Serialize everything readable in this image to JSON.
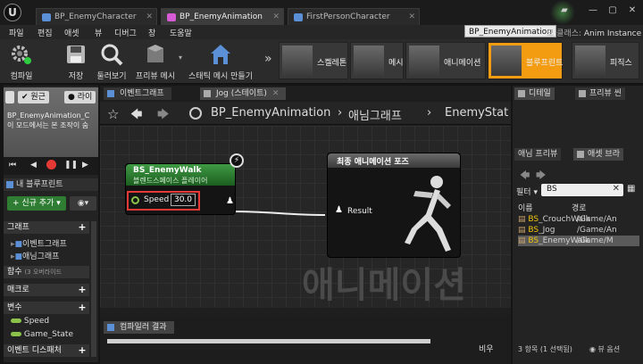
{
  "tabs": [
    {
      "label": "BP_EnemyCharacter"
    },
    {
      "label": "BP_EnemyAnimation"
    },
    {
      "label": "FirstPersonCharacter"
    }
  ],
  "menu": [
    "파일",
    "편집",
    "애셋",
    "뷰",
    "디버그",
    "창",
    "도움말"
  ],
  "tooltip": "BP_EnemyAnimation",
  "parent_class_suffix": "모 클래스:",
  "parent_class": "Anim Instance",
  "toolbar": {
    "compile": "컴파일",
    "save": "저장",
    "browse": "둘러보기",
    "preview_mesh": "프리뷰 메시",
    "static_mesh": "스태틱 메시 만들기"
  },
  "modes": [
    {
      "label": "스켈레톤"
    },
    {
      "label": "메시"
    },
    {
      "label": "애니메이션"
    },
    {
      "label": "블루프린트"
    },
    {
      "label": "피직스"
    }
  ],
  "left": {
    "original_btn": "원근",
    "light_btn": "라이",
    "preview_text_1": "BP_EnemyAnimation_C",
    "preview_text_2": "이 모드에서는 본 조작이 숨",
    "mybp_title": "내 블루프린트",
    "add_new": "신규 추가",
    "sections": {
      "graphs": "그래프",
      "functions": "함수",
      "functions_note": "(3 오버라이드",
      "macros": "매크로",
      "variables": "변수",
      "dispatchers": "이벤트 디스패처"
    },
    "graph_items": [
      "이벤트그래프",
      "애님그래프"
    ],
    "variables": [
      "Speed",
      "Game_State"
    ]
  },
  "graph": {
    "tabs": [
      "이벤트그래프",
      "Jog (스테이트)"
    ],
    "crumbs": [
      "BP_EnemyAnimation",
      "애님그래프",
      "EnemyStat"
    ],
    "watermark": "애니메이션",
    "node1": {
      "title": "BS_EnemyWalk",
      "subtitle": "블렌드스페이스 플레이어",
      "pin": "Speed",
      "value": "30.0"
    },
    "node2": {
      "title": "최종 애니메이션 포즈",
      "pin": "Result"
    },
    "compiler_tab": "컴파일러 결과",
    "compiler_right": "비우"
  },
  "right": {
    "tabs_top": [
      "디테일",
      "프리뷰 씬"
    ],
    "tabs_mid": [
      "애님 프리뷰",
      "애셋 브라"
    ],
    "filter_label": "필터",
    "search": "BS",
    "col_name": "이름",
    "col_path": "경로",
    "assets": [
      {
        "prefix": "BS",
        "name": "_CrouchWalk",
        "path": "/Game/An"
      },
      {
        "prefix": "BS",
        "name": "_Jog",
        "path": "/Game/An"
      },
      {
        "prefix": "BS",
        "name": "_EnemyWalk",
        "path": "/Game/M"
      }
    ],
    "count": "3 항목 (1 선택됨)",
    "view_options": "뷰 옵션"
  },
  "colors": {
    "accent": "#f39c12",
    "node1_head": "#2e7d32",
    "highlight": "#f1c40f",
    "pin_box": "#e53935"
  }
}
